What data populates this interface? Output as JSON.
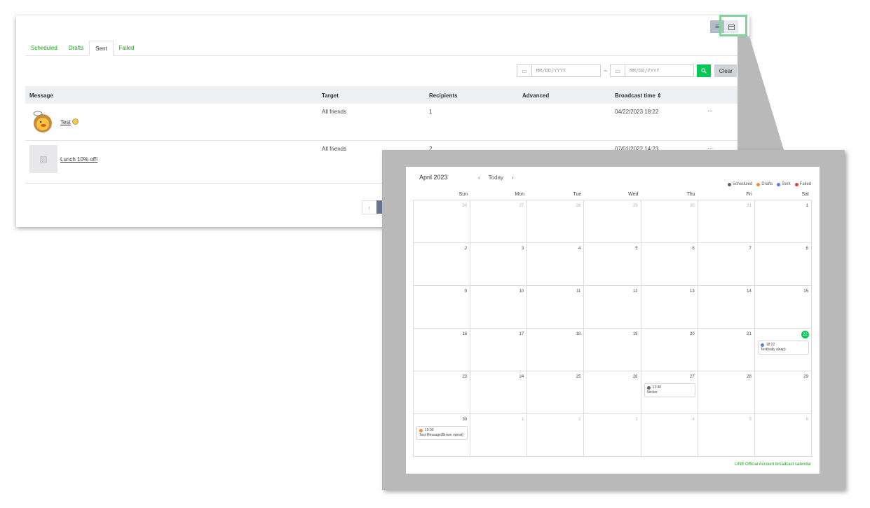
{
  "tabs": [
    {
      "label": "Scheduled"
    },
    {
      "label": "Drafts"
    },
    {
      "label": "Sent"
    },
    {
      "label": "Failed"
    }
  ],
  "active_tab": "Sent",
  "view_toggle": {
    "list_icon": "list-icon",
    "calendar_icon": "calendar-icon"
  },
  "filter": {
    "start_placeholder": "MM/DD/YYYY",
    "separator": "~",
    "end_placeholder": "MM/DD/YYYY",
    "clear_label": "Clear"
  },
  "table": {
    "headers": {
      "message": "Message",
      "target": "Target",
      "recipients": "Recipients",
      "advanced": "Advanced",
      "broadcast_time": "Broadcast time ⇕"
    },
    "rows": [
      {
        "message": "Test",
        "target": "All friends",
        "recipients": "1",
        "time": "04/22/2023 18:22",
        "more": "···"
      },
      {
        "message": "Lunch 10% off!",
        "target": "All friends",
        "recipients": "2",
        "time": "07/01/2022 14:23",
        "more": "···"
      }
    ]
  },
  "pager": {
    "prev": "‹"
  },
  "calendar": {
    "title": "April 2023",
    "prev": "‹",
    "today": "Today",
    "next": "›",
    "legend": [
      {
        "label": "Scheduled",
        "color": "#5b6478"
      },
      {
        "label": "Drafts",
        "color": "#f08a3c"
      },
      {
        "label": "Sent",
        "color": "#5b7fe0"
      },
      {
        "label": "Failed",
        "color": "#e9433c"
      }
    ],
    "weekdays": [
      "Sun",
      "Mon",
      "Tue",
      "Wed",
      "Thu",
      "Fri",
      "Sat"
    ],
    "weeks": [
      [
        "26",
        "27",
        "28",
        "29",
        "30",
        "31",
        "1"
      ],
      [
        "2",
        "3",
        "4",
        "5",
        "6",
        "7",
        "8"
      ],
      [
        "9",
        "10",
        "11",
        "12",
        "13",
        "14",
        "15"
      ],
      [
        "16",
        "17",
        "18",
        "19",
        "20",
        "21",
        "22"
      ],
      [
        "23",
        "24",
        "25",
        "26",
        "27",
        "28",
        "29"
      ],
      [
        "30",
        "1",
        "2",
        "3",
        "4",
        "5",
        "6"
      ]
    ],
    "today_day": "22",
    "events": [
      {
        "week": 3,
        "day": 6,
        "time": "18:22",
        "title": "Test(sally sleep)",
        "color": "#5b7fe0"
      },
      {
        "week": 4,
        "day": 4,
        "time": "12:30",
        "title": "Sticker",
        "color": "#5b6478"
      },
      {
        "week": 5,
        "day": 0,
        "time": "10:00",
        "title": "Test Message(Brown sweat)",
        "color": "#f08a3c"
      }
    ],
    "footer": "LINE Official Account broadcast calendar"
  }
}
